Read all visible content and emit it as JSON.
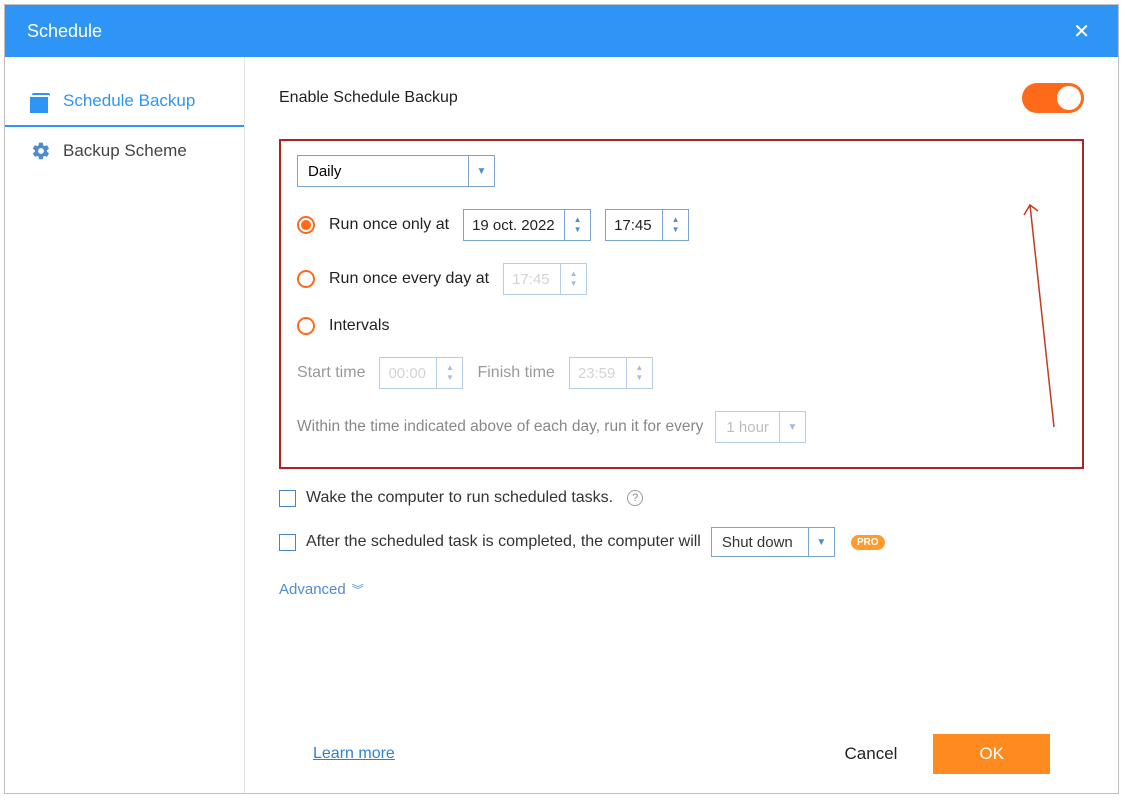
{
  "title": "Schedule",
  "sidebar": {
    "items": [
      {
        "label": "Schedule Backup"
      },
      {
        "label": "Backup Scheme"
      }
    ]
  },
  "enable": {
    "label": "Enable Schedule Backup",
    "on": true
  },
  "frequency": {
    "selected": "Daily"
  },
  "options": {
    "runOnceOnly": {
      "label": "Run once only at",
      "date": "19 oct. 2022",
      "time": "17:45"
    },
    "runEveryDay": {
      "label": "Run once every day at",
      "time": "17:45"
    },
    "intervals": {
      "label": "Intervals",
      "startLabel": "Start time",
      "start": "00:00",
      "finishLabel": "Finish time",
      "finish": "23:59",
      "withinText": "Within the time indicated above of each day, run it for every",
      "every": "1 hour"
    }
  },
  "checks": {
    "wake": "Wake the computer to run scheduled tasks.",
    "after": "After the scheduled task is completed, the computer will",
    "afterAction": "Shut down",
    "proBadge": "PRO"
  },
  "advanced": "Advanced",
  "footer": {
    "learnMore": "Learn more",
    "cancel": "Cancel",
    "ok": "OK"
  }
}
